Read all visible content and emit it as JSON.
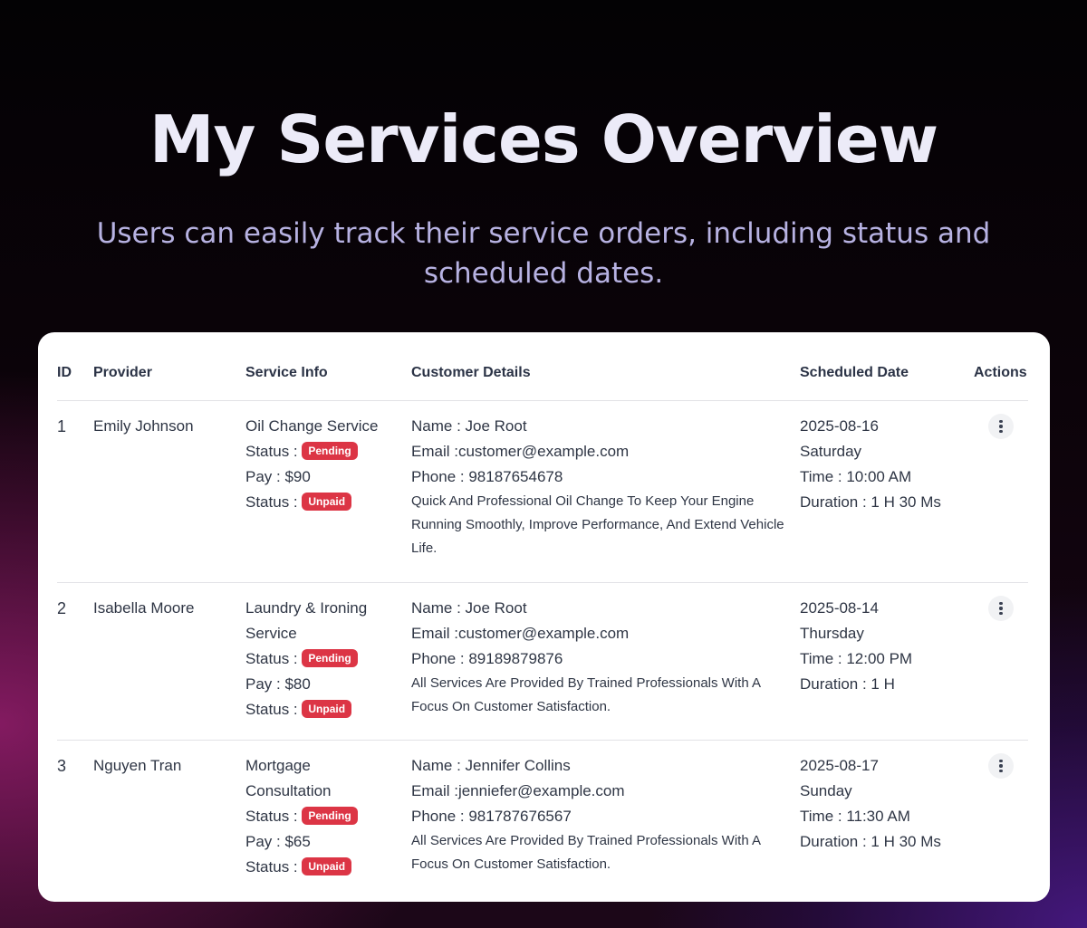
{
  "hero": {
    "title": "My Services Overview",
    "subtitle": "Users can easily track their service orders, including status and scheduled dates."
  },
  "table": {
    "headers": {
      "id": "ID",
      "provider": "Provider",
      "service_info": "Service Info",
      "customer_details": "Customer Details",
      "scheduled_date": "Scheduled Date",
      "actions": "Actions"
    },
    "rows": [
      {
        "id": "1",
        "provider": "Emily Johnson",
        "service_name": "Oil Change Service",
        "status_label": "Status :",
        "status": "Pending",
        "pay": "Pay : $90",
        "payment_label": "Status :",
        "payment_status": "Unpaid",
        "customer_name": "Name : Joe Root",
        "customer_email": "Email :customer@example.com",
        "customer_phone": "Phone : 98187654678",
        "description": "Quick And Professional Oil Change To Keep Your Engine Running Smoothly, Improve Performance, And Extend Vehicle Life.",
        "date": "2025-08-16",
        "day": "Saturday",
        "time": "Time : 10:00 AM",
        "duration": "Duration : 1 H 30 Ms",
        "actions_icon": "vertical-ellipsis-icon"
      },
      {
        "id": "2",
        "provider": "Isabella Moore",
        "service_name_line1": "Laundry & Ironing",
        "service_name_line2": "Service",
        "status_label": "Status :",
        "status": "Pending",
        "pay": "Pay : $80",
        "payment_label": "Status :",
        "payment_status": "Unpaid",
        "customer_name": "Name : Joe Root",
        "customer_email": "Email :customer@example.com",
        "customer_phone": "Phone : 89189879876",
        "description": "All Services Are Provided By Trained Professionals With A Focus On Customer Satisfaction.",
        "date": "2025-08-14",
        "day": "Thursday",
        "time": "Time : 12:00 PM",
        "duration": "Duration : 1 H",
        "actions_icon": "vertical-ellipsis-icon"
      },
      {
        "id": "3",
        "provider": "Nguyen Tran",
        "service_name_line1": "Mortgage",
        "service_name_line2": "Consultation",
        "status_label": "Status :",
        "status": "Pending",
        "pay": "Pay : $65",
        "payment_label": "Status :",
        "payment_status": "Unpaid",
        "customer_name": "Name : Jennifer Collins",
        "customer_email": "Email :jenniefer@example.com",
        "customer_phone": "Phone : 981787676567",
        "description": "All Services Are Provided By Trained Professionals With A Focus On Customer Satisfaction.",
        "date": "2025-08-17",
        "day": "Sunday",
        "time": "Time : 11:30 AM",
        "duration": "Duration : 1 H 30 Ms",
        "actions_icon": "vertical-ellipsis-icon"
      }
    ]
  },
  "colors": {
    "badge_red": "#dc3545",
    "title_text": "#ecebf8",
    "subtitle_text": "#b7b2e2"
  }
}
